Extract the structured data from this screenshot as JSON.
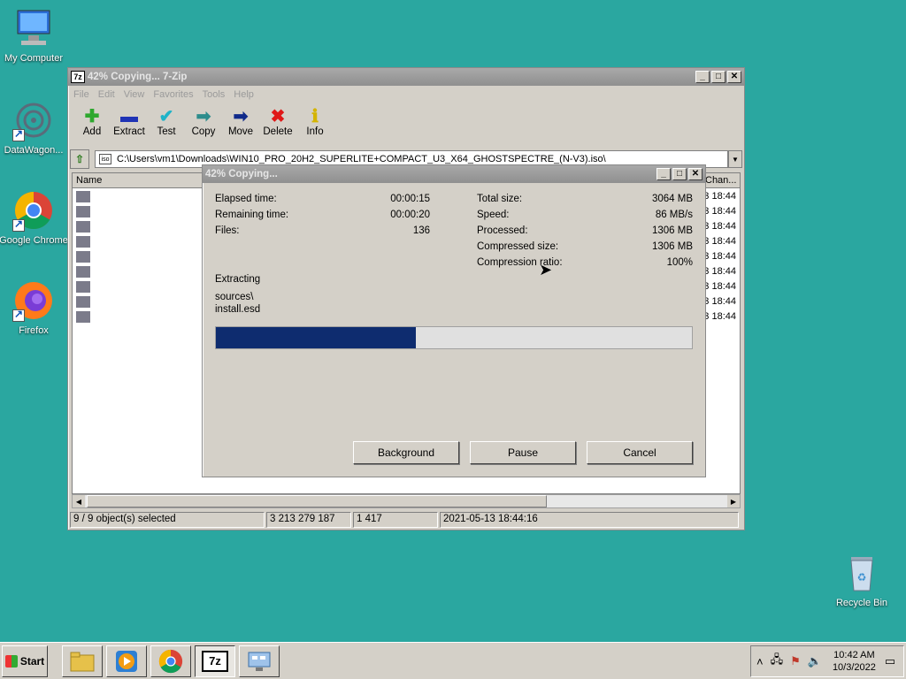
{
  "desktop": {
    "icons": [
      {
        "label": "My Computer",
        "icon": "computer-icon"
      },
      {
        "label": "DataWagon...",
        "icon": "datawagon-icon"
      },
      {
        "label": "Google Chrome",
        "icon": "chrome-icon"
      },
      {
        "label": "Firefox",
        "icon": "firefox-icon"
      },
      {
        "label": "Recycle Bin",
        "icon": "recycle-bin-icon"
      }
    ]
  },
  "main_window": {
    "title": "42% Copying... 7-Zip",
    "app_icon": "7z",
    "menu": [
      "File",
      "Edit",
      "View",
      "Favorites",
      "Tools",
      "Help"
    ],
    "toolbar": [
      {
        "label": "Add",
        "icon": "plus-icon",
        "color": "#2ea82e"
      },
      {
        "label": "Extract",
        "icon": "minus-icon",
        "color": "#1f33b5"
      },
      {
        "label": "Test",
        "icon": "check-icon",
        "color": "#1fb3c8"
      },
      {
        "label": "Copy",
        "icon": "copy-arrow-icon",
        "color": "#2d8c8c"
      },
      {
        "label": "Move",
        "icon": "move-arrow-icon",
        "color": "#102a8a"
      },
      {
        "label": "Delete",
        "icon": "delete-x-icon",
        "color": "#e01818"
      },
      {
        "label": "Info",
        "icon": "info-icon",
        "color": "#d4b400"
      }
    ],
    "address": "C:\\Users\\vm1\\Downloads\\WIN10_PRO_20H2_SUPERLITE+COMPACT_U3_X64_GHOSTSPECTRE_(N-V3).iso\\",
    "list": {
      "col_name": "Name",
      "col_changed": "Chan...",
      "rows": [
        "3 18:44",
        "3 18:44",
        "3 18:44",
        "3 18:44",
        "3 18:44",
        "3 18:44",
        "3 18:44",
        "3 18:44",
        "3 18:44"
      ]
    },
    "status": {
      "selected": "9 / 9 object(s) selected",
      "size": "3 213 279 187",
      "count": "1 417",
      "date": "2021-05-13 18:44:16"
    }
  },
  "dialog": {
    "title": "42% Copying...",
    "left_stats": [
      {
        "label": "Elapsed time:",
        "value": "00:00:15"
      },
      {
        "label": "Remaining time:",
        "value": "00:00:20"
      },
      {
        "label": "Files:",
        "value": "136"
      }
    ],
    "right_stats": [
      {
        "label": "Total size:",
        "value": "3064 MB"
      },
      {
        "label": "Speed:",
        "value": "86 MB/s"
      },
      {
        "label": "Processed:",
        "value": "1306 MB"
      },
      {
        "label": "Compressed size:",
        "value": "1306 MB"
      },
      {
        "label": "Compression ratio:",
        "value": "100%"
      }
    ],
    "operation": "Extracting",
    "path_line1": "sources\\",
    "path_line2": "install.esd",
    "progress": 0.42,
    "buttons": {
      "background": "Background",
      "pause": "Pause",
      "cancel": "Cancel"
    }
  },
  "taskbar": {
    "start": "Start",
    "clock_time": "10:42 AM",
    "clock_date": "10/3/2022"
  }
}
